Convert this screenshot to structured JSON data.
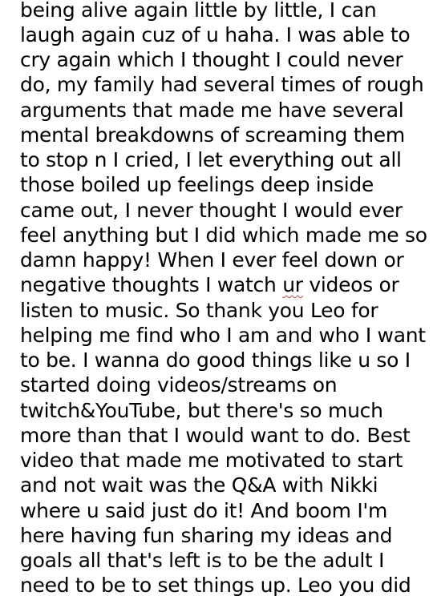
{
  "document": {
    "lines": [
      "being alive again little by little, I can",
      "laugh again cuz of u haha. I was able to",
      "cry again which I thought I could never",
      "do, my family had several times of rough",
      "arguments that made me have several",
      "mental breakdowns of screaming them",
      "to stop n I cried, I let everything out all",
      "those boiled up feelings deep inside",
      "came out, I never thought I would ever",
      "feel anything but I did which made me so",
      "damn happy! When I ever feel down or",
      "negative thoughts I watch ur videos or",
      "listen to music. So thank you Leo for",
      "helping me find who I am and who I want",
      "to be. I wanna do good things like u so I",
      "started doing videos/streams on",
      "twitch&YouTube, but there's so much",
      "more than that I would want to do. Best",
      "video that made me motivated to start",
      "and not wait was the Q&A with Nikki",
      "where u said just do it! And boom I'm",
      "here having fun sharing my ideas and",
      "goals all that's left is to be the adult I",
      "need to be to set things up. Leo you did"
    ],
    "line12_before": "negative thoughts I watch ",
    "line12_flagged": "ur",
    "line12_after": " videos or",
    "spellcheck_color": "#e53935",
    "text_color": "#000000",
    "background_color": "#ffffff"
  }
}
